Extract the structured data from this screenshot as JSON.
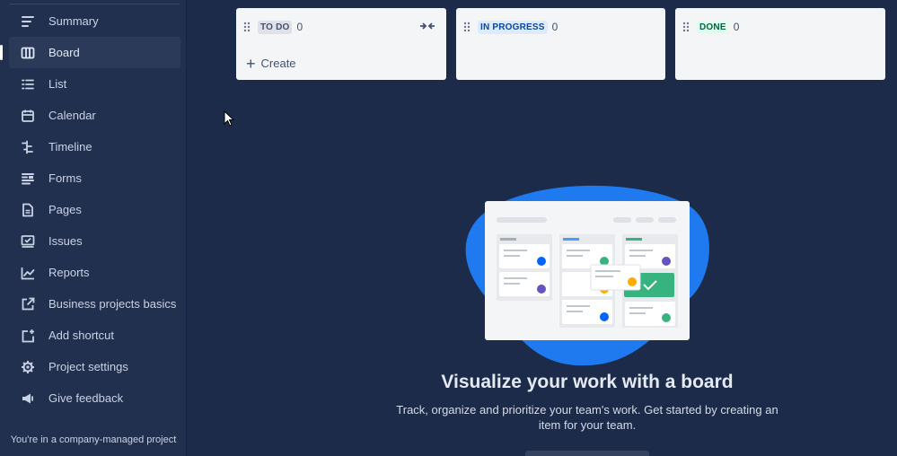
{
  "sidebar": {
    "items": [
      {
        "label": "Summary",
        "icon": "summary-icon"
      },
      {
        "label": "Board",
        "icon": "board-icon",
        "active": true
      },
      {
        "label": "List",
        "icon": "list-icon"
      },
      {
        "label": "Calendar",
        "icon": "calendar-icon"
      },
      {
        "label": "Timeline",
        "icon": "timeline-icon"
      },
      {
        "label": "Forms",
        "icon": "forms-icon"
      },
      {
        "label": "Pages",
        "icon": "pages-icon"
      },
      {
        "label": "Issues",
        "icon": "issues-icon"
      },
      {
        "label": "Reports",
        "icon": "reports-icon"
      },
      {
        "label": "Business projects basics",
        "icon": "external-link-icon"
      },
      {
        "label": "Add shortcut",
        "icon": "add-shortcut-icon"
      },
      {
        "label": "Project settings",
        "icon": "gear-icon"
      },
      {
        "label": "Give feedback",
        "icon": "megaphone-icon"
      }
    ],
    "footer": "You're in a company-managed project"
  },
  "board": {
    "columns": [
      {
        "status": "TO DO",
        "count": "0"
      },
      {
        "status": "IN PROGRESS",
        "count": "0"
      },
      {
        "status": "DONE",
        "count": "0"
      }
    ],
    "create_label": "Create"
  },
  "empty_state": {
    "title": "Visualize your work with a board",
    "description": "Track, organize and prioritize your team's work. Get started by creating an item for your team."
  },
  "colors": {
    "background": "#1d2b4a",
    "sidebar": "#22304f",
    "column": "#f4f5f7",
    "blob": "#1f7af0",
    "accent_green": "#36b37e"
  }
}
